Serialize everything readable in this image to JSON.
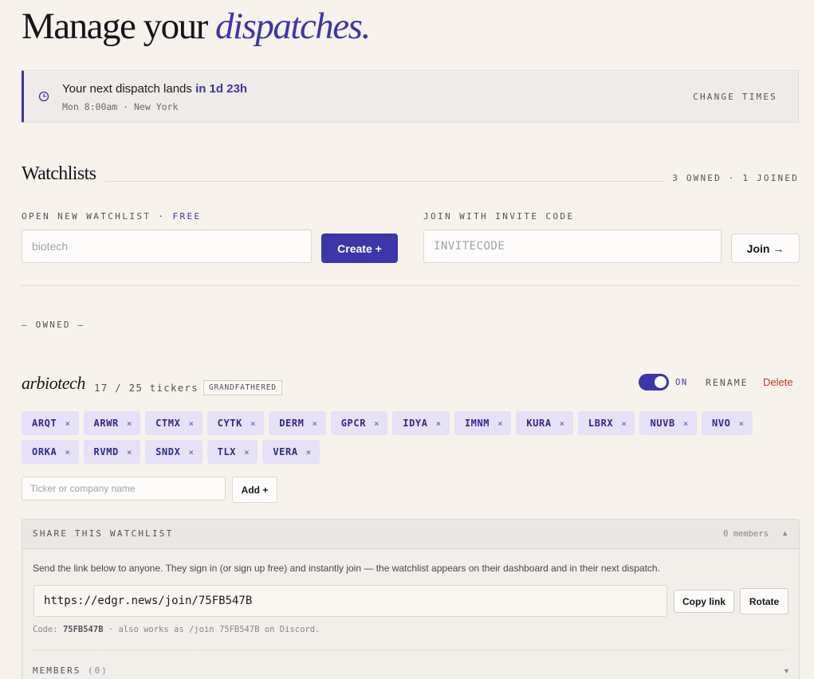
{
  "header": {
    "title_prefix": "Manage your",
    "title_accent": "dispatches."
  },
  "banner": {
    "icon": "clock-icon",
    "headline_prefix": "Your next dispatch lands",
    "headline_eta": "in 1d 23h",
    "schedule": "Mon 8:00am · New York",
    "change_label": "CHANGE TIMES"
  },
  "watchlists": {
    "heading": "Watchlists",
    "counts": "3 OWNED · 1 JOINED",
    "create": {
      "label": "OPEN NEW WATCHLIST",
      "label_sep": " · ",
      "label_free": "FREE",
      "placeholder": "biotech",
      "value": "",
      "button": "Create  +"
    },
    "join": {
      "label": "JOIN WITH INVITE CODE",
      "placeholder": "INVITECODE",
      "value": "",
      "button": "Join  →"
    },
    "owned_label": "— OWNED —"
  },
  "watchlist": {
    "name": "arbiotech",
    "count": "17 / 25 tickers",
    "badge": "GRANDFATHERED",
    "toggle_on": true,
    "toggle_label": "ON",
    "rename_label": "RENAME",
    "delete_label": "Delete",
    "remove_glyph": "×",
    "tickers": [
      "ARQT",
      "ARWR",
      "CTMX",
      "CYTK",
      "DERM",
      "GPCR",
      "IDYA",
      "IMNM",
      "KURA",
      "LBRX",
      "NUVB",
      "NVO",
      "ORKA",
      "RVMD",
      "SNDX",
      "TLX",
      "VERA"
    ],
    "add_placeholder": "Ticker or company name",
    "add_button": "Add +"
  },
  "share": {
    "title": "SHARE THIS WATCHLIST",
    "members_count": "0 members",
    "caret": "▲",
    "description": "Send the link below to anyone. They sign in (or sign up free) and instantly join — the watchlist appears on their dashboard and in their next dispatch.",
    "link": "https://edgr.news/join/75FB547B",
    "copy_button": "Copy link",
    "rotate_button": "Rotate",
    "code_label": "Code:",
    "code_value": "75FB547B",
    "code_suffix_1": "· also works as /join",
    "code_suffix_code": "75FB547B",
    "code_suffix_2": "on Discord.",
    "members_label": "MEMBERS",
    "members_n": "(0)",
    "members_caret": "▼"
  },
  "colors": {
    "background": "#f7f3ec",
    "accent": "#3d36a8",
    "chip_bg": "#e6e1f7",
    "danger": "#c0392b"
  }
}
